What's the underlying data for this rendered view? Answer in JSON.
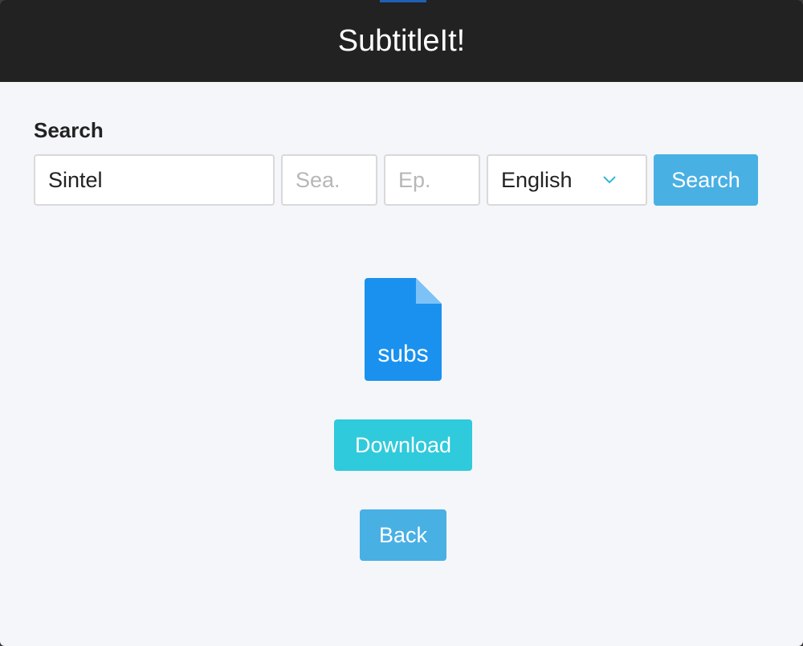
{
  "window": {
    "title": "SubtitleIt!"
  },
  "search": {
    "label": "Search",
    "query_value": "Sintel",
    "season_placeholder": "Sea.",
    "episode_placeholder": "Ep.",
    "language_selected": "English",
    "button_label": "Search"
  },
  "result": {
    "file_icon": "file-icon",
    "file_label": "subs",
    "download_label": "Download",
    "back_label": "Back"
  },
  "colors": {
    "titlebar": "#222222",
    "background": "#f4f6fa",
    "primary_button": "#49b0e4",
    "download_button": "#2fcadb",
    "file_icon": "#1a91ee"
  }
}
